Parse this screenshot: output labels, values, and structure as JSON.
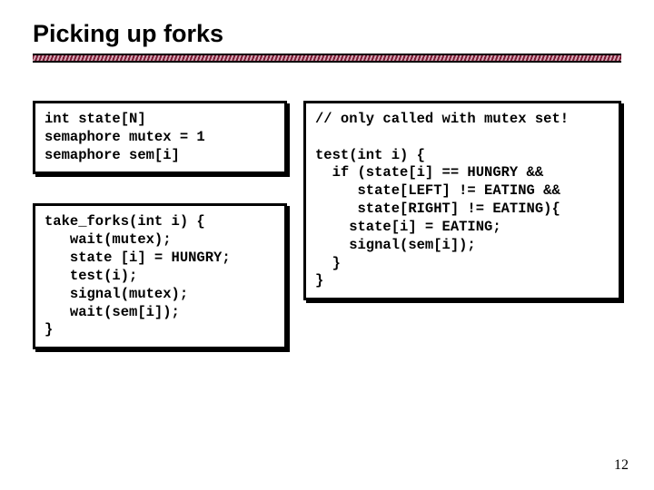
{
  "title": "Picking up forks",
  "codeboxes": {
    "decls": "int state[N]\nsemaphore mutex = 1\nsemaphore sem[i]",
    "take_forks": "take_forks(int i) {\n   wait(mutex);\n   state [i] = HUNGRY;\n   test(i);\n   signal(mutex);\n   wait(sem[i]);\n}",
    "test": "// only called with mutex set!\n\ntest(int i) {\n  if (state[i] == HUNGRY &&\n     state[LEFT] != EATING &&\n     state[RIGHT] != EATING){\n    state[i] = EATING;\n    signal(sem[i]);\n  }\n}"
  },
  "page_number": "12"
}
